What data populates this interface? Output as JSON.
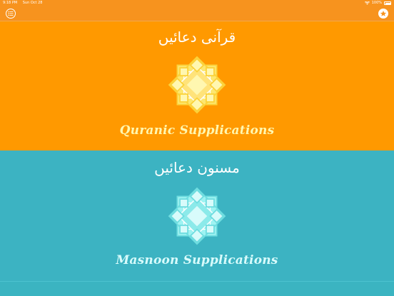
{
  "status_bar": {
    "time": "9:18 PM",
    "date": "Sun Oct 28",
    "battery": "100%"
  },
  "navbar": {
    "left_icon": "list-icon",
    "right_icon": "star-icon"
  },
  "panels": [
    {
      "urdu_title": "قرآنی دعائیں",
      "caption": "Quranic Supplications",
      "background": "#ff9900",
      "emblem_outer": "#fde76f",
      "emblem_inner": "#fff7b0",
      "emblem_stroke": "#fbd23a"
    },
    {
      "urdu_title": "مسنون دعائیں",
      "caption": "Masnoon Supplications",
      "background": "#3cb3c2",
      "emblem_outer": "#9ff3f2",
      "emblem_inner": "#d8fbfb",
      "emblem_stroke": "#6fdde0"
    }
  ]
}
